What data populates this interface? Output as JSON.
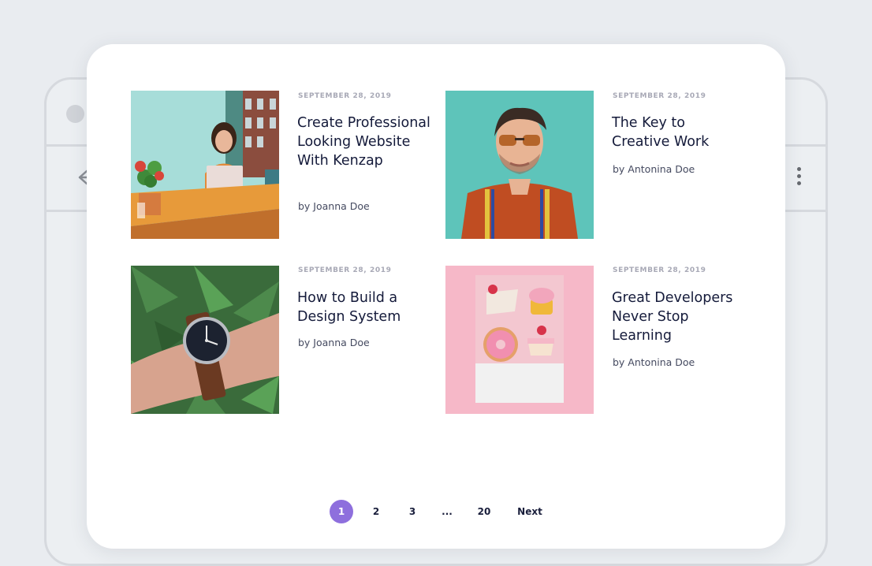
{
  "posts": [
    {
      "date": "SEPTEMBER 28, 2019",
      "title": "Create Professional Looking Website With Kenzap",
      "author": "by Joanna Doe"
    },
    {
      "date": "SEPTEMBER 28, 2019",
      "title": "The Key to Creative Work",
      "author": "by Antonina Doe"
    },
    {
      "date": "SEPTEMBER 28, 2019",
      "title": "How to Build a Design System",
      "author": "by Joanna Doe"
    },
    {
      "date": "SEPTEMBER 28, 2019",
      "title": "Great Developers Never Stop Learning",
      "author": "by Antonina Doe"
    }
  ],
  "pagination": {
    "pages": [
      "1",
      "2",
      "3",
      "...",
      "20"
    ],
    "next": "Next",
    "active": "1"
  },
  "colors": {
    "accent": "#8e6fdd",
    "title": "#141a3a",
    "date": "#a8a9b6",
    "background": "#e9ecf0"
  }
}
